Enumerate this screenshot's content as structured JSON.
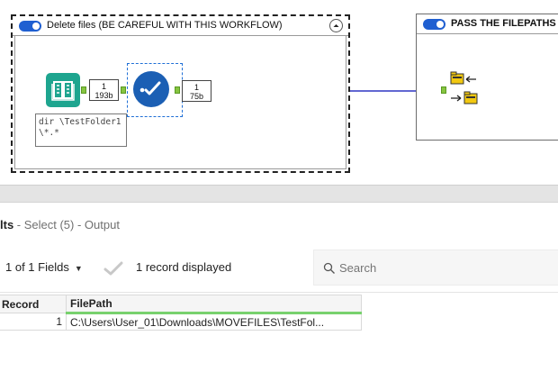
{
  "canvas": {
    "container1": {
      "title": "Delete files (BE CAREFUL WITH THIS WORKFLOW)",
      "collapse_icon": "chevron-up-icon",
      "input_tool": {
        "icon": "book-icon",
        "color": "#1ea58f"
      },
      "input_count": {
        "records": "1",
        "size": "193b"
      },
      "select_tool": {
        "icon": "checkmark-icon",
        "color": "#1b5fb4"
      },
      "select_count": {
        "records": "1",
        "size": "75b"
      },
      "annotation": {
        "line1": "dir \\TestFolder1",
        "line2": "\\*.*"
      }
    },
    "container2": {
      "title": "PASS THE FILEPATHS TO BE DELETED",
      "tool_icon": "move-files-icon"
    },
    "connection_color": "#2e35c4",
    "toggle_color": "#1f5fd1"
  },
  "results": {
    "title_bold": "lts",
    "title_rest": " - Select (5) - Output",
    "fields_label": "1 of 1 Fields",
    "record_count": "1 record displayed",
    "search_placeholder": "Search",
    "columns": [
      "Record",
      "FilePath"
    ],
    "rows": [
      {
        "record": "1",
        "filepath": "C:\\Users\\User_01\\Downloads\\MOVEFILES\\TestFol..."
      }
    ]
  }
}
